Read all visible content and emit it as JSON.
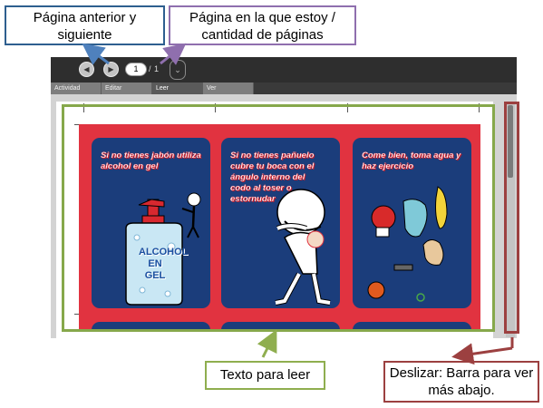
{
  "toolbar": {
    "prev_icon": "◀",
    "next_icon": "▶",
    "current_page": "1",
    "page_separator": "/",
    "total_pages": "1",
    "menu_icon": "⌄"
  },
  "tabs": [
    {
      "label": "Actividad"
    },
    {
      "label": "Editar"
    },
    {
      "label": "Leer"
    },
    {
      "label": "Ver"
    }
  ],
  "poster": {
    "panels": [
      {
        "text": "Si no tienes jabón utiliza alcohol en gel",
        "image_label": "ALCOHOL EN GEL"
      },
      {
        "text": "Si no tienes pañuelo cubre tu boca con el ángulo interno del codo al toser o estornudar"
      },
      {
        "text": "Come bien, toma agua y haz ejercicio"
      }
    ]
  },
  "annotations": {
    "nav_buttons": "Página anterior y siguiente",
    "page_indicator": "Página en la que estoy / cantidad de páginas",
    "read_area": "Texto para leer",
    "scroll": "Deslizar: Barra para ver más abajo."
  },
  "colors": {
    "toolbar": "#2e2e2e",
    "poster_background": "#e13340",
    "panel_background": "#1b3d7b",
    "nav_callout_border": "#2e5f8f",
    "page_callout_border": "#8f6fae",
    "read_callout_border": "#8fae4f",
    "scroll_callout_border": "#9c4040"
  }
}
